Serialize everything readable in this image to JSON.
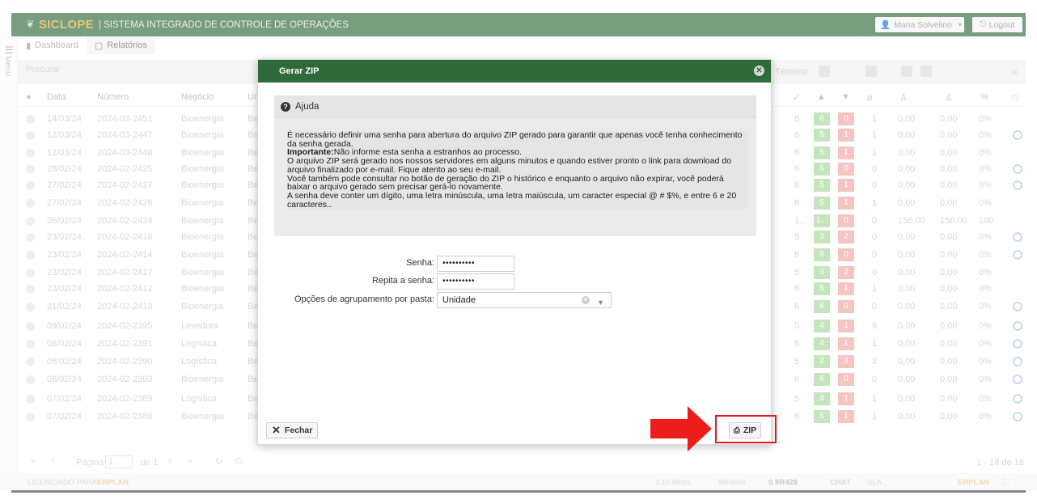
{
  "app": {
    "logo": "SICLOPE",
    "subtitle": "| SISTEMA INTEGRADO DE CONTROLE DE OPERAÇÕES",
    "user": "Maria Solvelino",
    "logout": "Logout"
  },
  "menu_label": "Menu",
  "tabs": [
    {
      "label": "Dashboard",
      "icon": "chart-icon"
    },
    {
      "label": "Relatórios",
      "icon": "report-icon"
    }
  ],
  "filter": {
    "search_placeholder": "Procurar",
    "termino": "Término"
  },
  "table": {
    "headers": [
      "Data",
      "Número",
      "Negócio",
      "Un"
    ],
    "rows": [
      {
        "data": "14/03/24",
        "numero": "2024-03-2451",
        "negocio": "Bioenergia",
        "un": "Be",
        "n1": "6",
        "g": "6",
        "r": "0",
        "c": "1",
        "v1": "0,00",
        "v2": "0,00",
        "pct": "0%",
        "clock": false
      },
      {
        "data": "12/03/24",
        "numero": "2024-03-2447",
        "negocio": "Bioenergia",
        "un": "Be",
        "n1": "6",
        "g": "5",
        "r": "1",
        "c": "1",
        "v1": "0,00",
        "v2": "0,00",
        "pct": "0%",
        "clock": true
      },
      {
        "data": "12/03/24",
        "numero": "2024-03-2448",
        "negocio": "Bioenergia",
        "un": "Be",
        "n1": "6",
        "g": "5",
        "r": "1",
        "c": "1",
        "v1": "0,00",
        "v2": "0,00",
        "pct": "0%",
        "clock": false
      },
      {
        "data": "28/02/24",
        "numero": "2024-02-2425",
        "negocio": "Bioenergia",
        "un": "Be",
        "n1": "6",
        "g": "6",
        "r": "0",
        "c": "0",
        "v1": "0,00",
        "v2": "0,00",
        "pct": "0%",
        "clock": true
      },
      {
        "data": "27/02/24",
        "numero": "2024-02-2427",
        "negocio": "Bioenergia",
        "un": "Be",
        "n1": "6",
        "g": "5",
        "r": "1",
        "c": "0",
        "v1": "0,00",
        "v2": "0,00",
        "pct": "0%",
        "clock": true
      },
      {
        "data": "27/02/24",
        "numero": "2024-02-2426",
        "negocio": "Bioenergia",
        "un": "Be",
        "n1": "6",
        "g": "5",
        "r": "1",
        "c": "1",
        "v1": "0,00",
        "v2": "0,00",
        "pct": "0%",
        "clock": false
      },
      {
        "data": "26/02/24",
        "numero": "2024-02-2424",
        "negocio": "Bioenergia",
        "un": "Be",
        "n1": "1...",
        "g": "1...",
        "r": "0",
        "c": "0",
        "v1": "156,00",
        "v2": "156,00",
        "pct": "100",
        "clock": false
      },
      {
        "data": "23/02/24",
        "numero": "2024-02-2418",
        "negocio": "Bioenergia",
        "un": "Be",
        "n1": "5",
        "g": "3",
        "r": "2",
        "c": "0",
        "v1": "0,00",
        "v2": "0,00",
        "pct": "0%",
        "clock": true
      },
      {
        "data": "23/02/24",
        "numero": "2024-02-2414",
        "negocio": "Bioenergia",
        "un": "Be",
        "n1": "6",
        "g": "6",
        "r": "0",
        "c": "0",
        "v1": "0,00",
        "v2": "0,00",
        "pct": "0%",
        "clock": true
      },
      {
        "data": "23/02/24",
        "numero": "2024-02-2417",
        "negocio": "Bioenergia",
        "un": "Be",
        "n1": "5",
        "g": "3",
        "r": "2",
        "c": "0",
        "v1": "0,00",
        "v2": "0,00",
        "pct": "0%",
        "clock": false
      },
      {
        "data": "23/02/24",
        "numero": "2024-02-2412",
        "negocio": "Bioenergia",
        "un": "Be",
        "n1": "6",
        "g": "5",
        "r": "1",
        "c": "1",
        "v1": "0,00",
        "v2": "0,00",
        "pct": "0%",
        "clock": false
      },
      {
        "data": "21/02/24",
        "numero": "2024-02-2413",
        "negocio": "Bioenergia",
        "un": "Be",
        "n1": "6",
        "g": "6",
        "r": "0",
        "c": "0",
        "v1": "0,00",
        "v2": "0,00",
        "pct": "0%",
        "clock": true
      },
      {
        "data": "09/02/24",
        "numero": "2024-02-2395",
        "negocio": "Levedura",
        "un": "Be",
        "n1": "5",
        "g": "4",
        "r": "1",
        "c": "9",
        "v1": "0,00",
        "v2": "0,00",
        "pct": "0%",
        "clock": true
      },
      {
        "data": "08/02/24",
        "numero": "2024-02-2391",
        "negocio": "Logística",
        "un": "Be",
        "n1": "5",
        "g": "4",
        "r": "1",
        "c": "1",
        "v1": "0,00",
        "v2": "0,00",
        "pct": "0%",
        "clock": true
      },
      {
        "data": "08/02/24",
        "numero": "2024-02-2390",
        "negocio": "Logística",
        "un": "Be",
        "n1": "5",
        "g": "2",
        "r": "3",
        "c": "3",
        "v1": "0,00",
        "v2": "0,00",
        "pct": "0%",
        "clock": true
      },
      {
        "data": "08/02/24",
        "numero": "2024-02-2393",
        "negocio": "Bioenergia",
        "un": "Be",
        "n1": "6",
        "g": "6",
        "r": "0",
        "c": "0",
        "v1": "0,00",
        "v2": "0,00",
        "pct": "0%",
        "clock": true
      },
      {
        "data": "07/02/24",
        "numero": "2024-02-2389",
        "negocio": "Logística",
        "un": "Be",
        "n1": "5",
        "g": "4",
        "r": "1",
        "c": "1",
        "v1": "0,00",
        "v2": "0,00",
        "pct": "0%",
        "clock": true
      },
      {
        "data": "07/02/24",
        "numero": "2024-02-2388",
        "negocio": "Bioenergia",
        "un": "Be",
        "n1": "6",
        "g": "5",
        "r": "1",
        "c": "1",
        "v1": "0,00",
        "v2": "0,00",
        "pct": "0%",
        "clock": true
      }
    ]
  },
  "pager": {
    "pagina_label": "Página",
    "page": "1",
    "de": "de 1",
    "count": "1 - 18 de 18"
  },
  "footer": {
    "licenciado": "LICENCIADO PARA:",
    "erplan": "ERPLAN",
    "speed": "3.10 Mbps",
    "ping": "99m69s",
    "version": "0.9R428",
    "chat": "CHAT",
    "sla": "SLA"
  },
  "modal": {
    "title": "Gerar ZIP",
    "help_title": "Ajuda",
    "help_lines": [
      "É necessário definir uma senha para abertura do arquivo ZIP gerado para garantir que apenas você tenha conhecimento da senha gerada.",
      "Não informe esta senha a estranhos ao processo.",
      "O arquivo ZIP será gerado nos nossos servidores em alguns minutos e quando estiver pronto o link para download do arquivo finalizado por e-mail. Fique atento ao seu e-mail.",
      "Você também pode consultar no botão de geração do ZIP o histórico e enquanto o arquivo não expirar, você poderá baixar o arquivo gerado sem precisar gerá-lo novamente.",
      "A senha deve conter um dígito, uma letra minúscula, uma letra maiúscula, um caracter especial @ # $%, e entre 6 e 20 caracteres.."
    ],
    "importante": "Importante:",
    "senha_label": "Senha:",
    "senha_value": "••••••••••",
    "repita_label": "Repita a senha:",
    "repita_value": "••••••••••",
    "opcoes_label": "Opções de agrupamento por pasta:",
    "opcoes_value": "Unidade",
    "fechar": "Fechar",
    "zip": "ZIP"
  },
  "colors": {
    "header_green": "#2f6b3a",
    "logo_orange": "#e2a537",
    "highlight_red": "#e51b1b"
  }
}
